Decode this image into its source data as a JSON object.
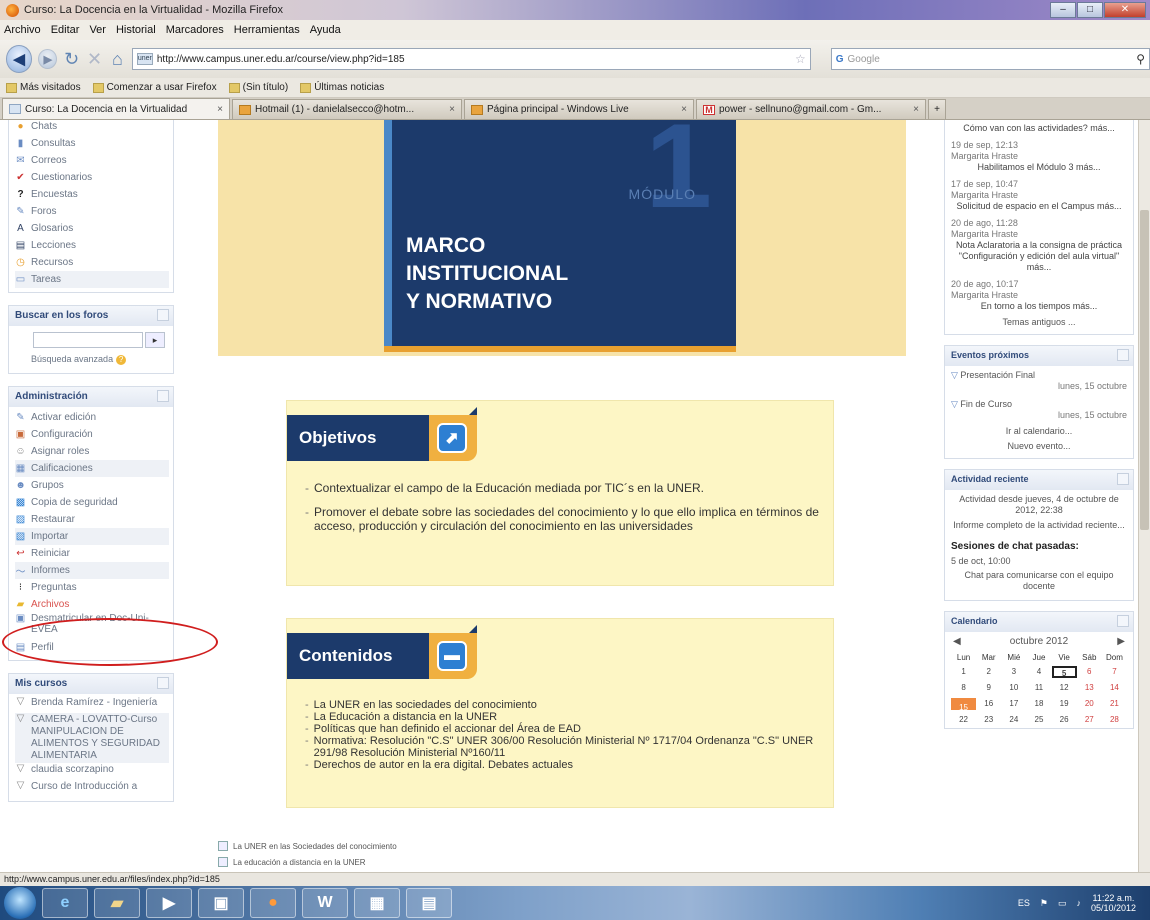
{
  "window": {
    "title": "Curso: La Docencia en la Virtualidad - Mozilla Firefox",
    "buttons": [
      "–",
      "□",
      "✕"
    ]
  },
  "menubar": [
    "Archivo",
    "Editar",
    "Ver",
    "Historial",
    "Marcadores",
    "Herramientas",
    "Ayuda"
  ],
  "navbar": {
    "url": "http://www.campus.uner.edu.ar/course/view.php?id=185",
    "search_placeholder": "Google"
  },
  "bookmarks": [
    "Más visitados",
    "Comenzar a usar Firefox",
    "(Sin título)",
    "Últimas noticias"
  ],
  "tabs": [
    {
      "label": "Curso: La Docencia en la Virtualidad",
      "active": true
    },
    {
      "label": "Hotmail (1) - danielalsecco@hotm...",
      "active": false
    },
    {
      "label": "Página principal - Windows Live",
      "active": false
    },
    {
      "label": "power - sellnuno@gmail.com - Gm...",
      "active": false
    }
  ],
  "left": {
    "activities": [
      {
        "label": "Chats",
        "icon": "chat-icon"
      },
      {
        "label": "Consultas",
        "icon": "chart-icon"
      },
      {
        "label": "Correos",
        "icon": "mail-icon"
      },
      {
        "label": "Cuestionarios",
        "icon": "check-icon"
      },
      {
        "label": "Encuestas",
        "icon": "question-icon"
      },
      {
        "label": "Foros",
        "icon": "forum-icon"
      },
      {
        "label": "Glosarios",
        "icon": "glossary-icon"
      },
      {
        "label": "Lecciones",
        "icon": "lesson-icon"
      },
      {
        "label": "Recursos",
        "icon": "resource-icon"
      },
      {
        "label": "Tareas",
        "icon": "task-icon"
      }
    ],
    "search_forums": {
      "title": "Buscar en los foros",
      "go": "Ir",
      "advanced": "Búsqueda avanzada"
    },
    "admin": {
      "title": "Administración",
      "items": [
        {
          "label": "Activar edición",
          "icon": "edit-icon"
        },
        {
          "label": "Configuración",
          "icon": "settings-icon"
        },
        {
          "label": "Asignar roles",
          "icon": "roles-icon"
        },
        {
          "label": "Calificaciones",
          "icon": "grades-icon"
        },
        {
          "label": "Grupos",
          "icon": "groups-icon"
        },
        {
          "label": "Copia de seguridad",
          "icon": "backup-icon"
        },
        {
          "label": "Restaurar",
          "icon": "restore-icon"
        },
        {
          "label": "Importar",
          "icon": "import-icon"
        },
        {
          "label": "Reiniciar",
          "icon": "reset-icon"
        },
        {
          "label": "Informes",
          "icon": "reports-icon"
        },
        {
          "label": "Preguntas",
          "icon": "questions-icon"
        },
        {
          "label": "Archivos",
          "icon": "folder-icon"
        },
        {
          "label": "Desmatricular en Doc-Uni-EVEA",
          "icon": "unenrol-icon"
        },
        {
          "label": "Perfil",
          "icon": "profile-icon"
        }
      ]
    },
    "courses": {
      "title": "Mis cursos",
      "items": [
        "Brenda Ramírez - Ingeniería",
        "CAMERA - LOVATTO-Curso MANIPULACION DE ALIMENTOS Y SEGURIDAD ALIMENTARIA",
        "claudia scorzapino",
        "Curso de Introducción a"
      ]
    }
  },
  "center": {
    "banner": {
      "number": "1",
      "module": "MÓDULO",
      "title_lines": [
        "MARCO",
        "INSTITUCIONAL",
        "Y NORMATIVO"
      ]
    },
    "objetivos": {
      "title": "Objetivos",
      "items": [
        "Contextualizar el campo de la Educación mediada por TIC´s en la UNER.",
        "Promover el debate sobre las sociedades del conocimiento y lo que ello implica en términos de acceso, producción y circulación del conocimiento en las universidades"
      ]
    },
    "contenidos": {
      "title": "Contenidos",
      "items": [
        "La UNER en las sociedades del conocimiento",
        "La Educación a distancia en la UNER",
        "Políticas que han definido el accionar del Área de EAD",
        "Normativa: Resolución \"C.S\" UNER 306/00 Resolución Ministerial Nº 1717/04 Ordenanza \"C.S\" UNER 291/98 Resolución Ministerial Nº160/11",
        "Derechos de autor en la era digital. Debates actuales"
      ]
    },
    "links": [
      "La UNER en las Sociedades del conocimiento",
      "La educación a distancia en la UNER"
    ]
  },
  "right": {
    "forum": [
      {
        "date": "",
        "author": "",
        "msg": "Cómo van con las actividades? más..."
      },
      {
        "date": "19 de sep, 12:13",
        "author": "Margarita Hraste",
        "msg": "Habilitamos el Módulo 3 más..."
      },
      {
        "date": "17 de sep, 10:47",
        "author": "Margarita Hraste",
        "msg": "Solicitud de espacio en el Campus más..."
      },
      {
        "date": "20 de ago, 11:28",
        "author": "Margarita Hraste",
        "msg": "Nota Aclaratoria a la consigna de práctica \"Configuración y edición del aula virtual\" más..."
      },
      {
        "date": "20 de ago, 10:17",
        "author": "Margarita Hraste",
        "msg": "En torno a los tiempos más..."
      }
    ],
    "forum_older": "Temas antiguos ...",
    "events": {
      "title": "Eventos próximos",
      "items": [
        {
          "label": "Presentación Final",
          "when": "lunes, 15 octubre"
        },
        {
          "label": "Fin de Curso",
          "when": "lunes, 15 octubre"
        }
      ],
      "calendar_link": "Ir al calendario...",
      "new_event": "Nuevo evento..."
    },
    "activity": {
      "title": "Actividad reciente",
      "since": "Actividad desde jueves, 4 de octubre de 2012, 22:38",
      "full": "Informe completo de la actividad reciente..."
    },
    "chat": {
      "title": "Sesiones de chat pasadas:",
      "date": "5 de oct, 10:00",
      "desc": "Chat para comunicarse con el equipo docente"
    },
    "calendar": {
      "title": "Calendario",
      "month": "octubre 2012",
      "headers": [
        "Lun",
        "Mar",
        "Mié",
        "Jue",
        "Vie",
        "Sáb",
        "Dom"
      ],
      "days": [
        [
          "1",
          "2",
          "3",
          "4",
          "5",
          "6",
          "7"
        ],
        [
          "8",
          "9",
          "10",
          "11",
          "12",
          "13",
          "14"
        ],
        [
          "15",
          "16",
          "17",
          "18",
          "19",
          "20",
          "21"
        ],
        [
          "22",
          "23",
          "24",
          "25",
          "26",
          "27",
          "28"
        ]
      ]
    }
  },
  "statusbar": "http://www.campus.uner.edu.ar/files/index.php?id=185",
  "tray": {
    "lang": "ES",
    "time": "11:22 a.m.",
    "date": "05/10/2012"
  }
}
